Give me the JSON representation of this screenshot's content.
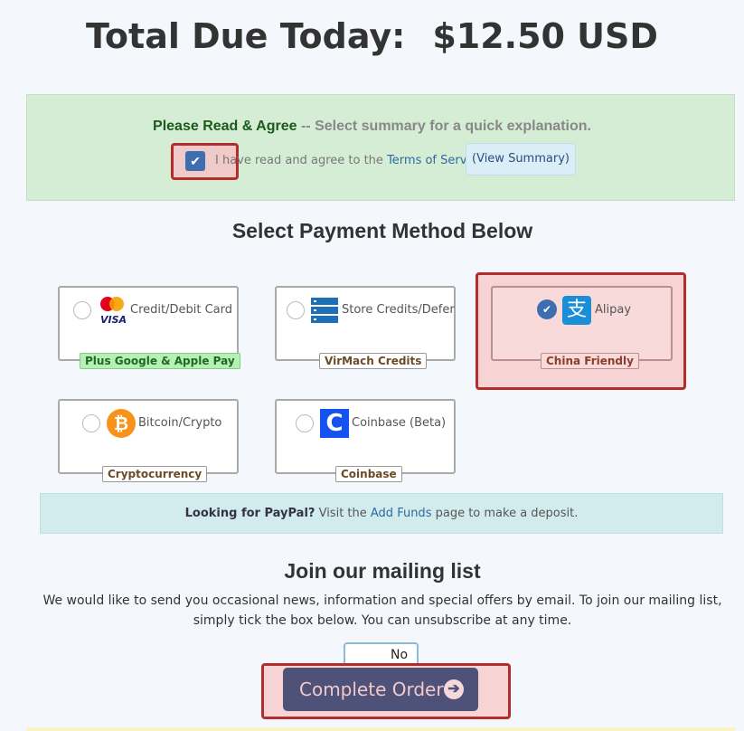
{
  "total": {
    "label": "Total Due Today:",
    "amount": "$12.50 USD"
  },
  "agreement": {
    "heading": "Please Read & Agree",
    "subheading": "-- Select summary for a quick explanation.",
    "checked": true,
    "checkbox_text": "I have read and agree to the",
    "terms_link": "Terms of Service",
    "view_summary_label": "(View Summary)"
  },
  "payment": {
    "title": "Select Payment Method Below",
    "methods": [
      {
        "label": "Credit/Debit Card",
        "badge": "Plus Google & Apple Pay",
        "icon": "mastercard-visa-icon",
        "selected": false
      },
      {
        "label": "Store Credits/Defer",
        "badge": "VirMach Credits",
        "icon": "server-stack-icon",
        "selected": false
      },
      {
        "label": "Alipay",
        "badge": "China Friendly",
        "icon": "alipay-icon",
        "selected": true
      },
      {
        "label": "Bitcoin/Crypto",
        "badge": "Cryptocurrency",
        "icon": "bitcoin-icon",
        "selected": false
      },
      {
        "label": "Coinbase (Beta)",
        "badge": "Coinbase",
        "icon": "coinbase-icon",
        "selected": false
      }
    ]
  },
  "paypal_notice": {
    "bold": "Looking for PayPal?",
    "text_before": " Visit the ",
    "link": "Add Funds",
    "text_after": " page to make a deposit."
  },
  "mailing": {
    "title": "Join our mailing list",
    "description": "We would like to send you occasional news, information and special offers by email. To join our mailing list, simply tick the box below. You can unsubscribe at any time.",
    "toggle_label": "No"
  },
  "order": {
    "button_label": "Complete Order"
  },
  "colors": {
    "accent": "#4e5278",
    "highlight": "#b32d2d",
    "success_bg": "#d5ecd5",
    "info_bg": "#d2ecee",
    "link": "#2d6aa0"
  }
}
